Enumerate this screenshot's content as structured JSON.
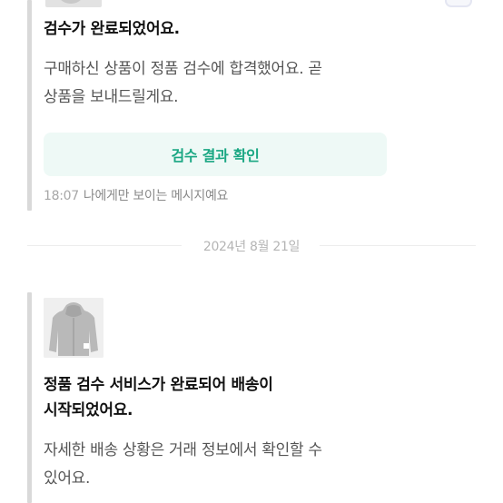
{
  "message1": {
    "title": "검수가 완료되었어요.",
    "body_line1": "구매하신 상품이 정품 검수에 합격했어요. 곧",
    "body_line2": "상품을 보내드릴게요.",
    "button_label": "검수 결과 확인",
    "time": "18:07",
    "visibility_note": "나에게만 보이는 메시지예요"
  },
  "date_separator": "2024년 8월 21일",
  "message2": {
    "product_image": "hoodie-product-photo",
    "title_line1": "정품 검수 서비스가 완료되어 배송이",
    "title_line2": "시작되었어요.",
    "body_line1": "자세한 배송 상황은 거래 정보에서 확인할 수",
    "body_line2": "있어요."
  },
  "colors": {
    "accent_green": "#1aa783",
    "button_bg": "#eef9f6",
    "quote_bar": "#d9d9d9"
  }
}
